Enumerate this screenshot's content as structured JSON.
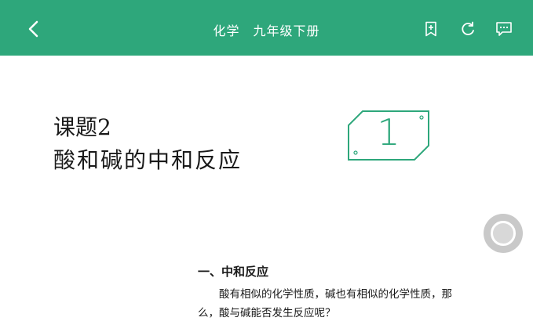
{
  "header": {
    "title": "化学　九年级下册",
    "back_icon": "chevron-left-icon",
    "actions": [
      "bookmark-add-icon",
      "refresh-icon",
      "comment-icon"
    ],
    "bg_color": "#2ea77b"
  },
  "lesson": {
    "number": "课题2",
    "name": "酸和碱的中和反应",
    "badge_digit": "1"
  },
  "section": {
    "title": "一、中和反应",
    "paragraph": "酸有相似的化学性质，碱也有相似的化学性质，那么，酸与碱能否发生反应呢？"
  },
  "floating_button": "assistive-touch-icon"
}
